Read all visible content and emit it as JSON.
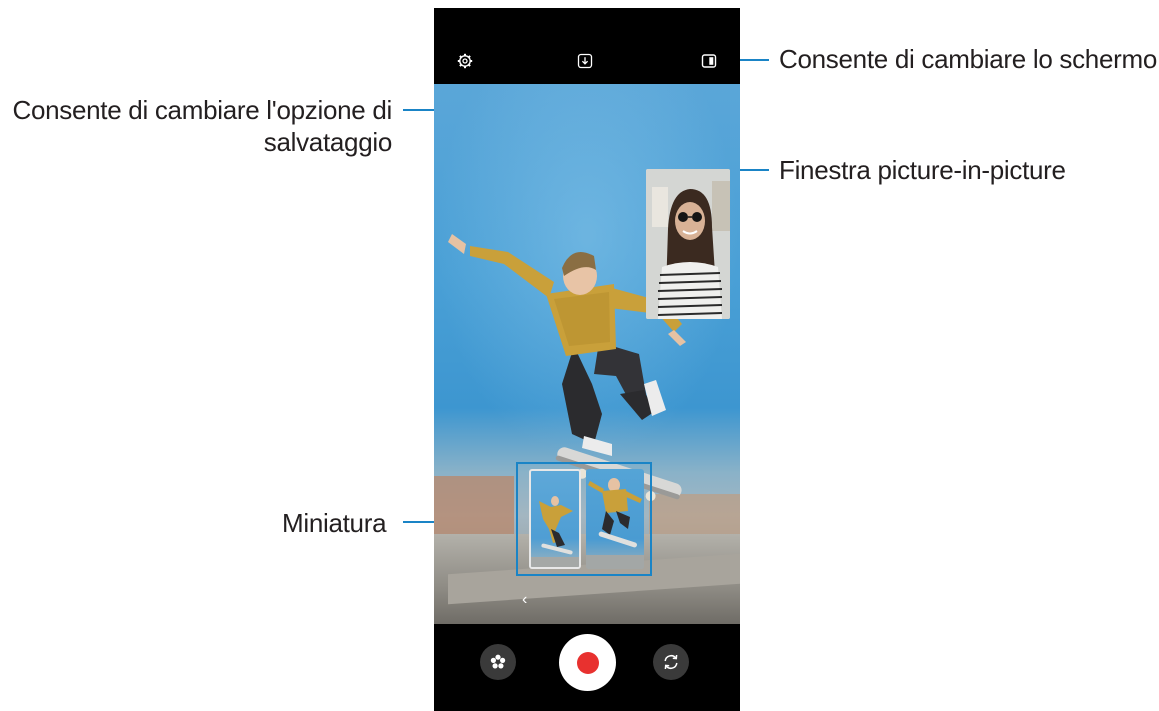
{
  "callouts": {
    "change_screen": "Consente di cambiare lo schermo",
    "save_option_line1": "Consente di cambiare l'opzione di",
    "save_option_line2": "salvataggio",
    "pip_window": "Finestra picture-in-picture",
    "thumbnail": "Miniatura"
  },
  "icons": {
    "settings": "gear-icon",
    "save_option": "download-icon",
    "screen_layout": "split-screen-icon",
    "back": "chevron-left-icon",
    "effects": "flower-icon",
    "record": "record-icon",
    "switch_camera": "rotate-icon"
  },
  "colors": {
    "leader_line": "#1a84c6",
    "record_dot": "#e8312f",
    "label_text": "#231f20"
  }
}
